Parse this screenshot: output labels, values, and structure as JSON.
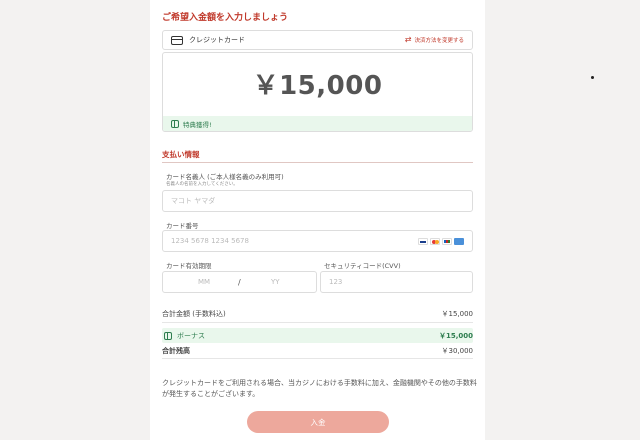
{
  "amount_section": {
    "title": "ご希望入金額を入力しましょう",
    "method_label": "クレジットカード",
    "change_method": "決済方法を変更する",
    "amount": "￥15,000",
    "bonus_note": "特典獲得!"
  },
  "payment": {
    "title": "支払い情報",
    "holder_label": "カード名義人 (ご本人様名義のみ利用可)",
    "holder_sub": "名義人の名前を入力してください。",
    "holder_placeholder": "マコト ヤマダ",
    "card_number_label": "カード番号",
    "card_number_placeholder": "1234 5678 1234 5678",
    "card_brands": [
      "visa-icon",
      "mastercard-icon",
      "jcb-icon",
      "amex-icon"
    ],
    "expiry_label": "カード有効期限",
    "expiry_month_placeholder": "MM",
    "expiry_separator": "/",
    "expiry_year_placeholder": "YY",
    "cvv_label": "セキュリティコード(CVV)",
    "cvv_placeholder": "123"
  },
  "summary": {
    "total_label": "合計金額 (手数料込)",
    "total_value": "￥15,000",
    "bonus_label": "ボーナス",
    "bonus_value": "￥15,000",
    "balance_label": "合計残高",
    "balance_value": "￥30,000"
  },
  "note": "クレジットカードをご利用される場合、当カジノにおける手数料に加え、金融機関やその他の手数料が発生することがございます。",
  "deposit_button": "入金",
  "colors": {
    "accent": "#c0392b",
    "bonus_bg": "#e9f7ec",
    "bonus_text": "#2e7d4f",
    "button": "#eda89c"
  }
}
